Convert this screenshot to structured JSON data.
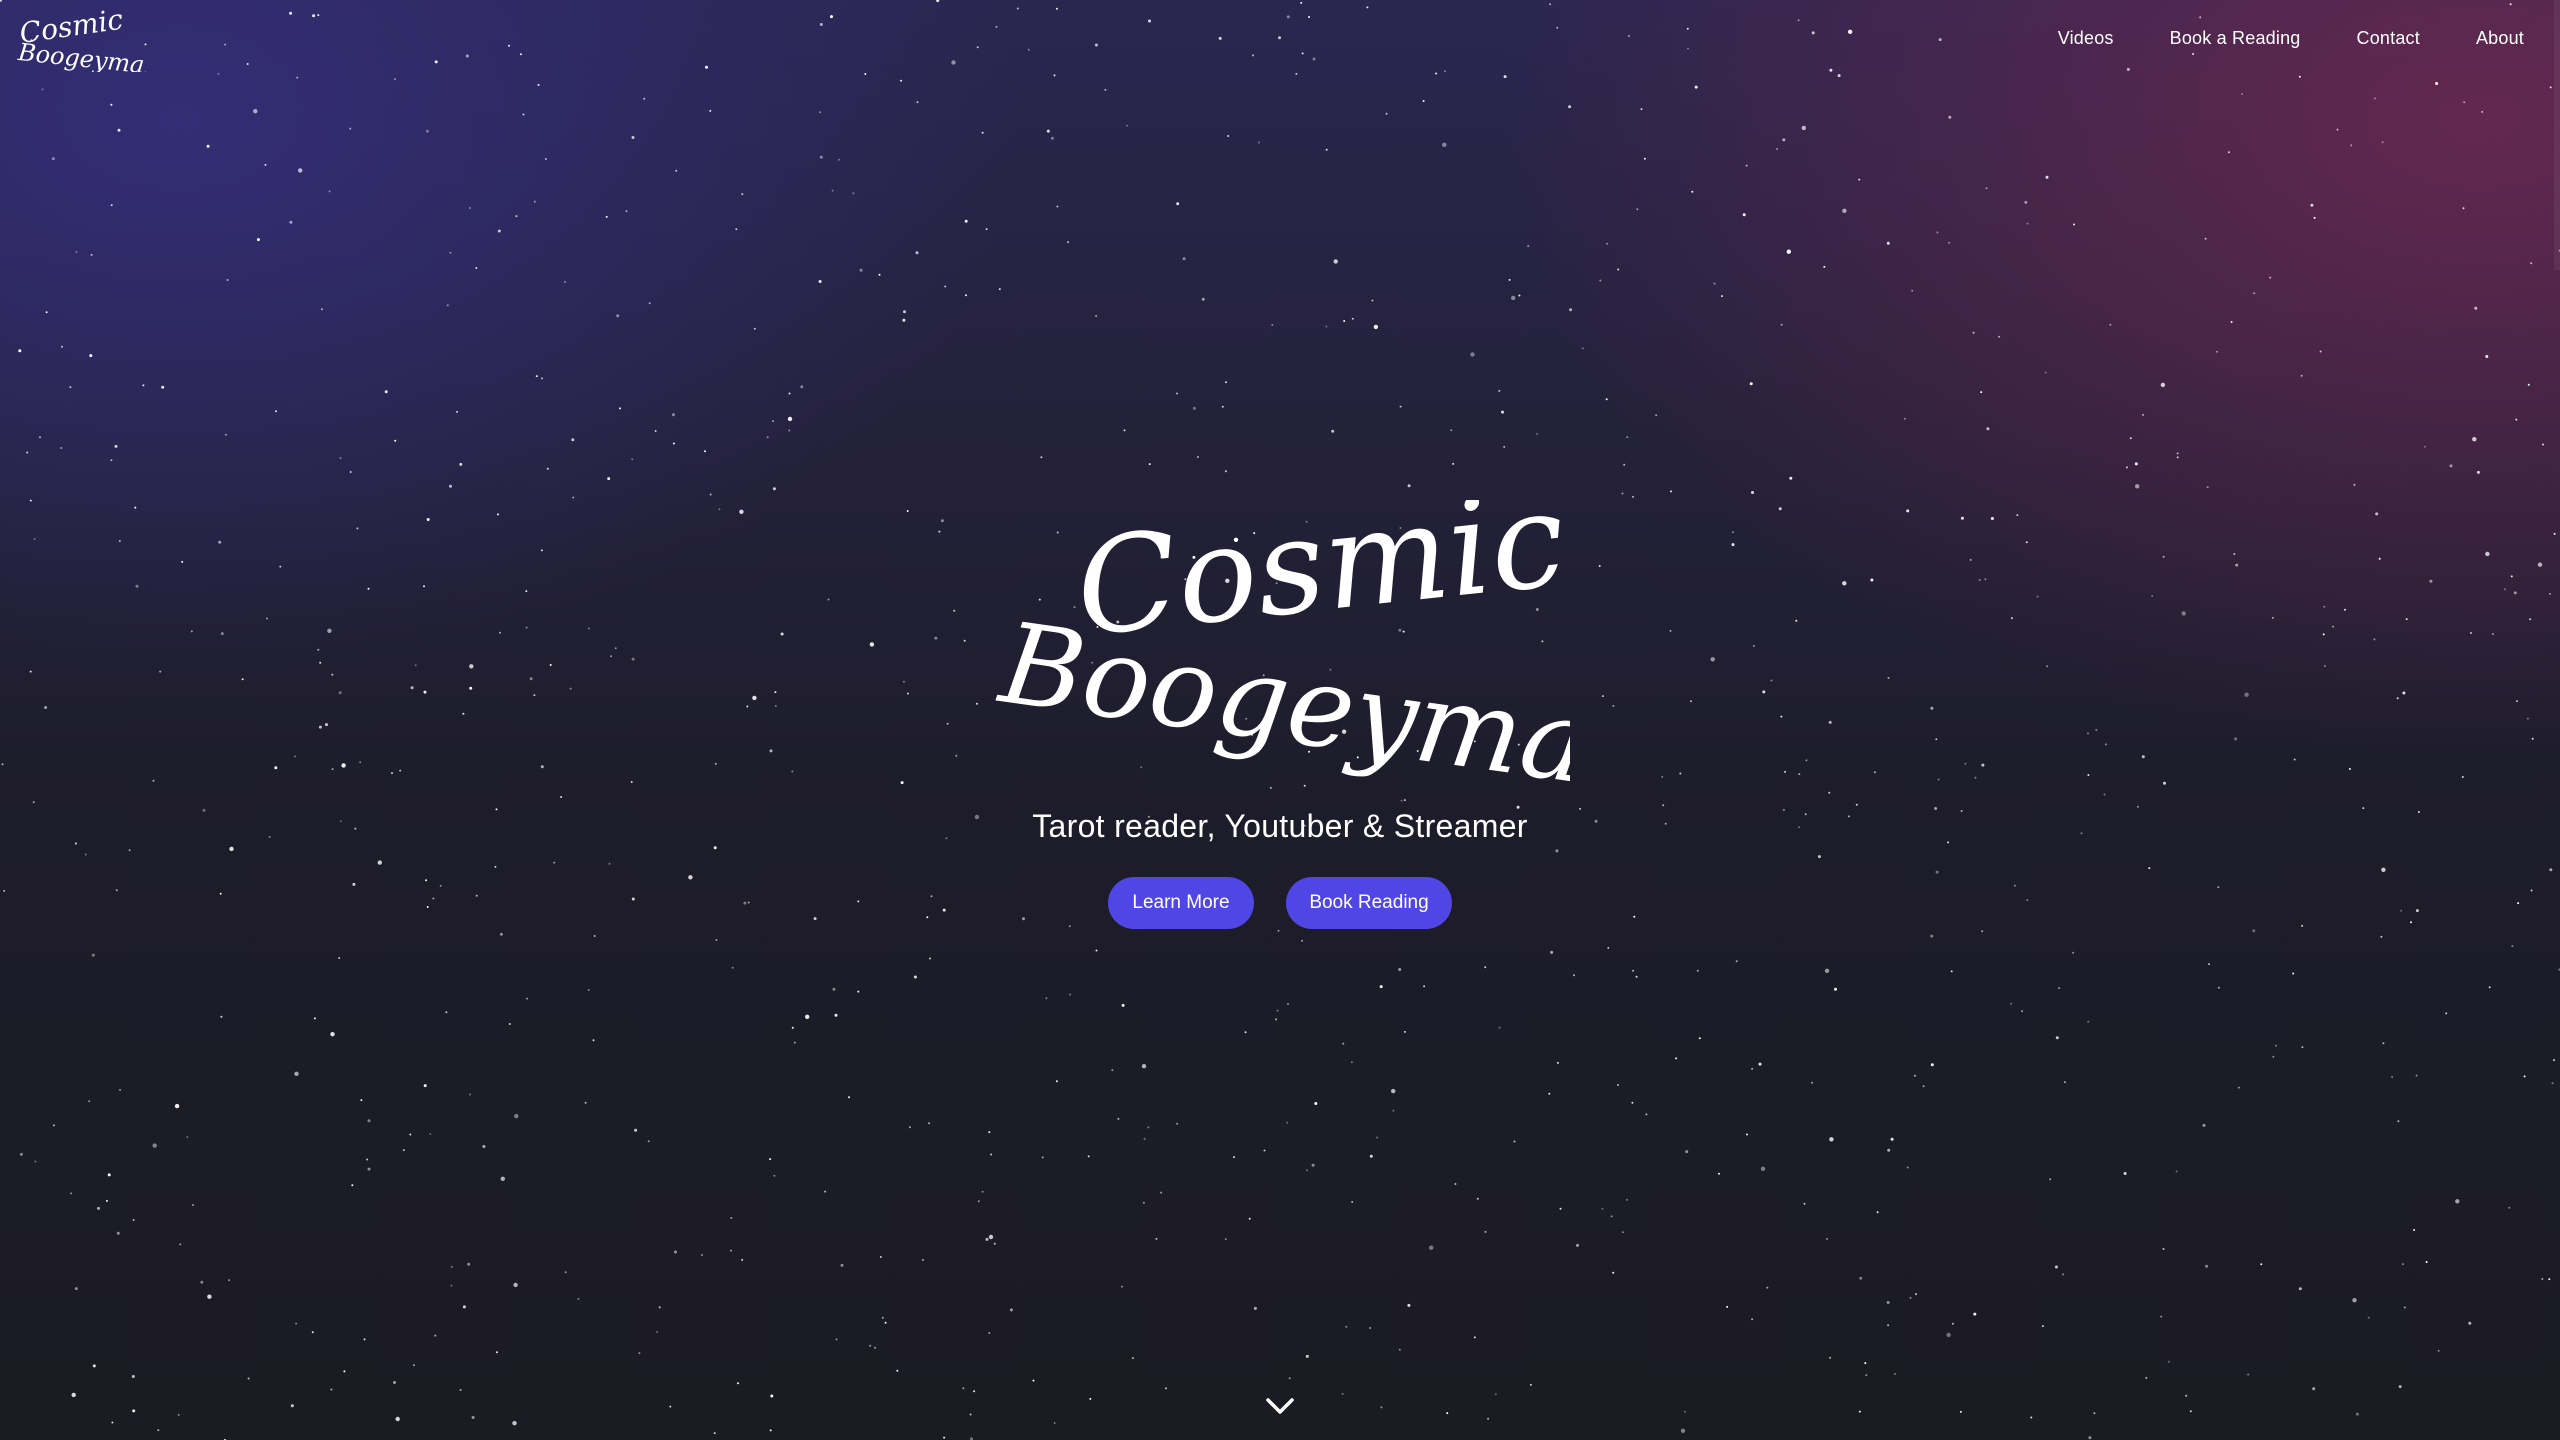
{
  "site": {
    "brand_line1": "Cosmic",
    "brand_line2": "Boogeyman"
  },
  "nav": {
    "items": [
      {
        "label": "Videos"
      },
      {
        "label": "Book a Reading"
      },
      {
        "label": "Contact"
      },
      {
        "label": "About"
      }
    ]
  },
  "hero": {
    "title_line1": "Cosmic",
    "title_line2": "Boogeyman",
    "tagline": "Tarot reader, Youtuber & Streamer",
    "buttons": {
      "learn_more": "Learn More",
      "book_reading": "Book Reading"
    },
    "scroll_icon": "chevron-down-icon"
  },
  "colors": {
    "button_bg": "#4f46e5",
    "text": "#ffffff",
    "bg_dark": "#1b1b24",
    "bg_indigo": "#2a2650",
    "bg_magenta": "#6e2850"
  }
}
